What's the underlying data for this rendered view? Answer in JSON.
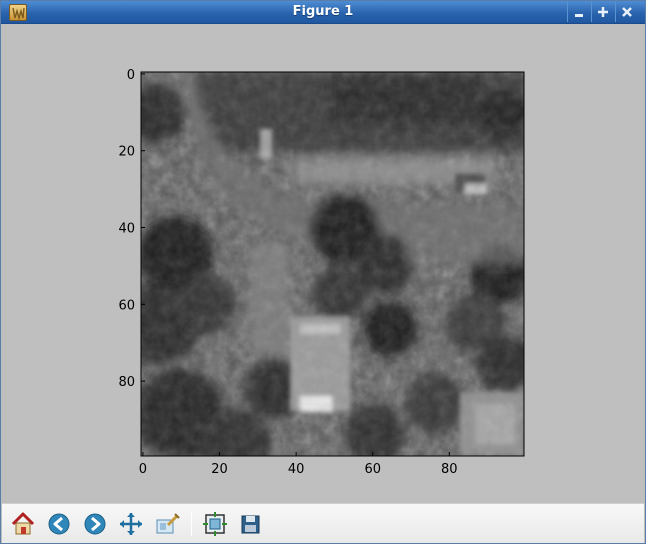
{
  "window": {
    "title": "Figure 1",
    "title_bar_color": "#2a64ae",
    "controls": [
      "minimize-icon",
      "maximize-icon",
      "close-icon"
    ]
  },
  "figure": {
    "background": "#bfbfbf",
    "image_kind": "grayscale aerial photograph"
  },
  "axes": {
    "x_ticks": [
      "0",
      "20",
      "40",
      "60",
      "80"
    ],
    "y_ticks": [
      "0",
      "20",
      "40",
      "60",
      "80"
    ],
    "xlim": [
      0,
      99
    ],
    "ylim": [
      99,
      0
    ],
    "grid": false
  },
  "toolbar": {
    "tools": [
      {
        "name": "home",
        "icon": "home-icon"
      },
      {
        "name": "back",
        "icon": "back-arrow-icon"
      },
      {
        "name": "forward",
        "icon": "forward-arrow-icon"
      },
      {
        "name": "pan",
        "icon": "pan-move-icon"
      },
      {
        "name": "zoom",
        "icon": "zoom-rect-icon"
      },
      {
        "name": "subplots",
        "icon": "subplots-icon"
      },
      {
        "name": "save",
        "icon": "save-floppy-icon"
      }
    ]
  }
}
